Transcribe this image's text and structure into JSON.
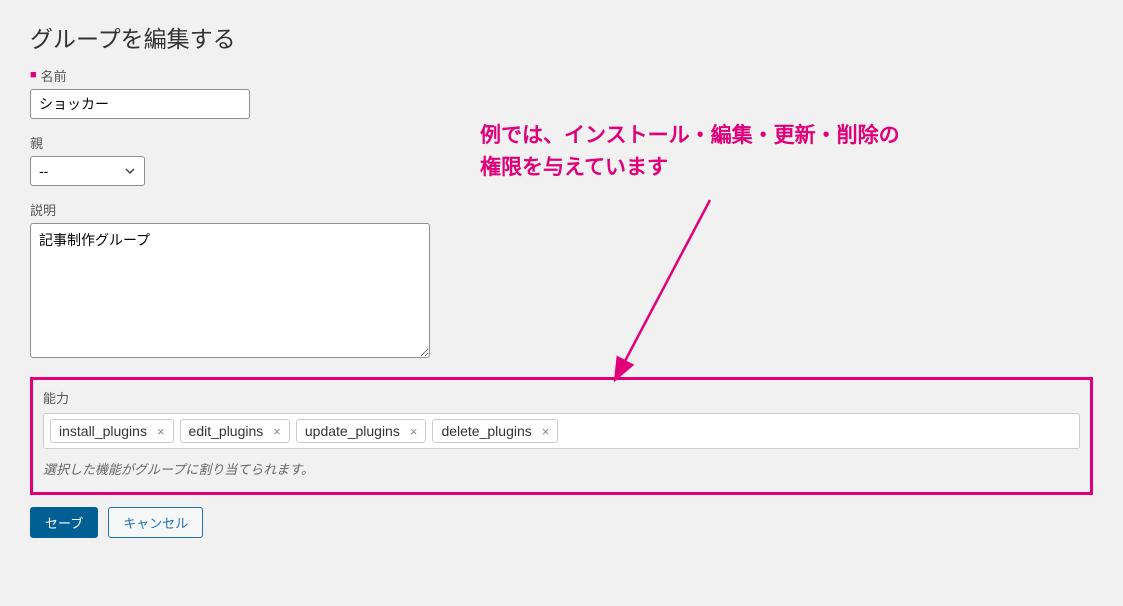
{
  "page": {
    "title": "グループを編集する"
  },
  "fields": {
    "name": {
      "label": "名前",
      "value": "ショッカー",
      "required": true
    },
    "parent": {
      "label": "親",
      "value": "--"
    },
    "description": {
      "label": "説明",
      "value": "記事制作グループ"
    },
    "capabilities": {
      "label": "能力",
      "tags": [
        {
          "name": "install_plugins"
        },
        {
          "name": "edit_plugins"
        },
        {
          "name": "update_plugins"
        },
        {
          "name": "delete_plugins"
        }
      ],
      "helper": "選択した機能がグループに割り当てられます。"
    }
  },
  "buttons": {
    "save": "セーブ",
    "cancel": "キャンセル"
  },
  "annotation": {
    "text": "例では、インストール・編集・更新・削除の\n権限を与えています"
  },
  "colors": {
    "accent": "#e2007a",
    "primary": "#015f94",
    "link": "#2271b1"
  }
}
